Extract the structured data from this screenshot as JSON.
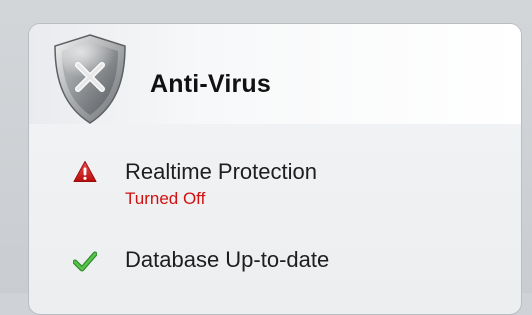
{
  "panel": {
    "title": "Anti-Virus",
    "shield_icon": "shield-x-icon"
  },
  "status_items": [
    {
      "label": "Realtime Protection",
      "sub_label": "Turned Off",
      "icon": "warning-triangle-icon",
      "status_color": "#d21010"
    },
    {
      "label": "Database Up-to-date",
      "icon": "checkmark-icon",
      "status_color": "#44a83a"
    }
  ]
}
